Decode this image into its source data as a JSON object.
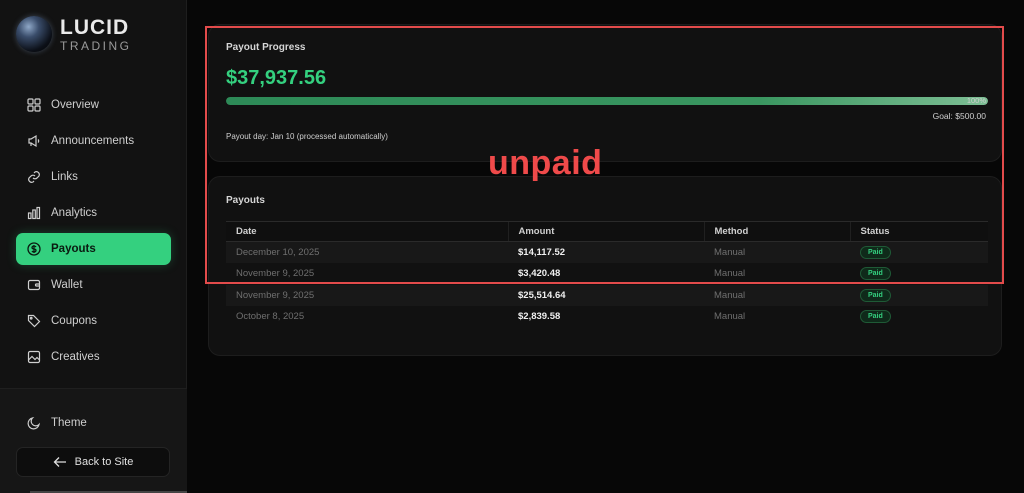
{
  "brand": {
    "name": "LUCID",
    "sub": "TRADING"
  },
  "sidebar": {
    "items": [
      {
        "label": "Overview"
      },
      {
        "label": "Announcements"
      },
      {
        "label": "Links"
      },
      {
        "label": "Analytics"
      },
      {
        "label": "Payouts",
        "active": true
      },
      {
        "label": "Wallet"
      },
      {
        "label": "Coupons"
      },
      {
        "label": "Creatives"
      }
    ],
    "theme_label": "Theme",
    "back_label": "Back to Site"
  },
  "progress": {
    "title": "Payout Progress",
    "amount": "$37,937.56",
    "percent_label": "100%",
    "percent_value": 1.0,
    "goal": "Goal: $500.00",
    "payout_day": "Payout day: Jan 10 (processed automatically)"
  },
  "payouts": {
    "title": "Payouts",
    "columns": [
      "Date",
      "Amount",
      "Method",
      "Status"
    ],
    "rows": [
      {
        "date": "December 10, 2025",
        "amount": "$14,117.52",
        "method": "Manual",
        "status": "Paid"
      },
      {
        "date": "November 9, 2025",
        "amount": "$3,420.48",
        "method": "Manual",
        "status": "Paid"
      },
      {
        "date": "November 9, 2025",
        "amount": "$25,514.64",
        "method": "Manual",
        "status": "Paid"
      },
      {
        "date": "October 8, 2025",
        "amount": "$2,839.58",
        "method": "Manual",
        "status": "Paid"
      }
    ]
  },
  "annotation": {
    "text": "unpaid",
    "color": "#ef4a4a"
  },
  "colors": {
    "accent": "#34d07f",
    "background": "#070707",
    "card": "#111111",
    "annotation_box": "#e24b4b"
  }
}
